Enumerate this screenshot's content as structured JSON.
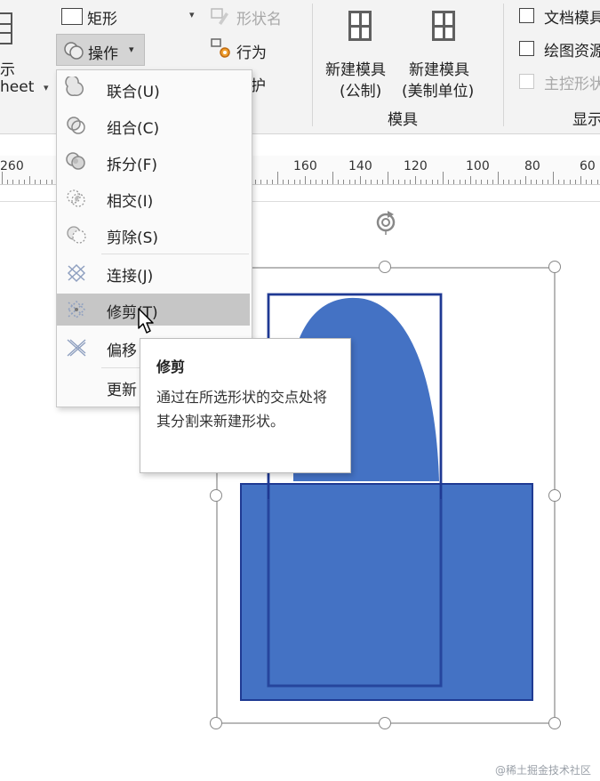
{
  "ribbon": {
    "rect_label": "矩形",
    "operation_label": "操作",
    "operation_caret": "▾",
    "shape_name_label": "形状名",
    "behavior_label": "行为",
    "protect_label": "护",
    "left_partial_1": "示",
    "left_partial_2": "heet",
    "new_template_metric_line1": "新建模具",
    "new_template_metric_line2": "(公制)",
    "new_template_us_line1": "新建模具",
    "new_template_us_line2": "(美制单位)",
    "template_group_label": "模具",
    "doc_template_label": "文档模具",
    "drawing_resource_label": "绘图资源",
    "master_shape_label": "主控形状",
    "show_group_label": "显示"
  },
  "ruler": {
    "labels": [
      "260",
      "160",
      "140",
      "120",
      "100",
      "80",
      "60"
    ]
  },
  "menu": {
    "items": [
      {
        "label": "联合(U)"
      },
      {
        "label": "组合(C)"
      },
      {
        "label": "拆分(F)"
      },
      {
        "label": "相交(I)"
      },
      {
        "label": "剪除(S)"
      },
      {
        "label": "连接(J)"
      },
      {
        "label": "修剪(T)"
      },
      {
        "label": "偏移"
      },
      {
        "label": "更新"
      }
    ]
  },
  "tooltip": {
    "title": "修剪",
    "description": "通过在所选形状的交点处将其分割来新建形状。"
  },
  "colors": {
    "shape_fill": "#4472c4",
    "shape_border": "#1f3a93",
    "menu_highlight": "#c6c6c6"
  },
  "watermark": "@稀土掘金技术社区"
}
